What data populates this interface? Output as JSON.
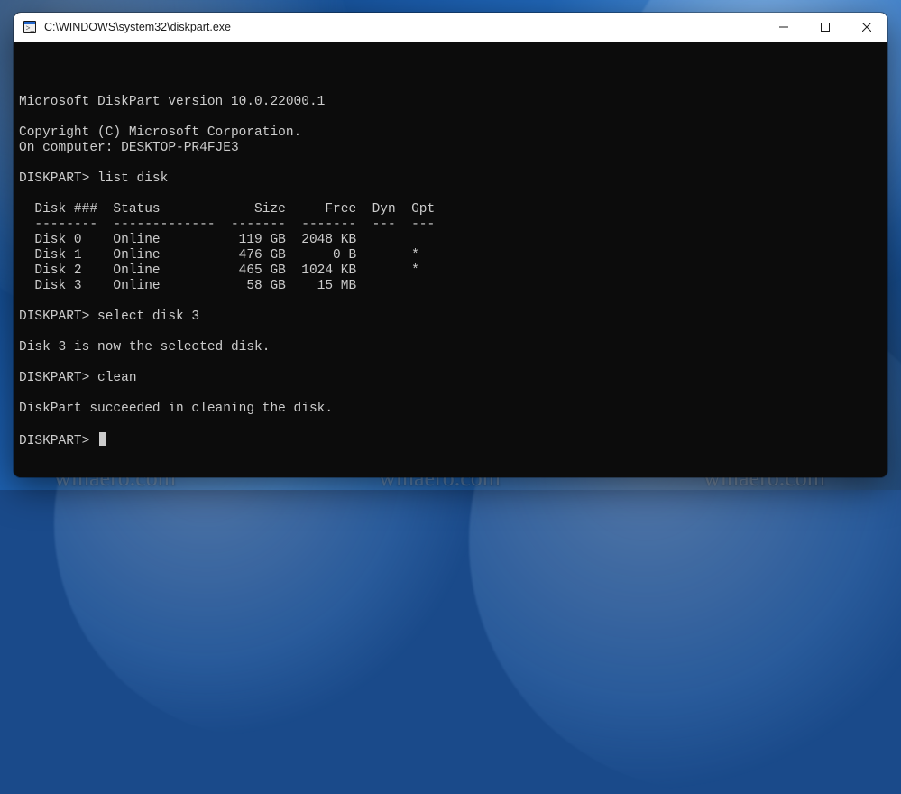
{
  "watermark": "winaero.com",
  "window": {
    "title": "C:\\WINDOWS\\system32\\diskpart.exe"
  },
  "terminal": {
    "version_line": "Microsoft DiskPart version 10.0.22000.1",
    "copyright_line": "Copyright (C) Microsoft Corporation.",
    "computer_line": "On computer: DESKTOP-PR4FJE3",
    "prompt": "DISKPART>",
    "cmd_list": "list disk",
    "cmd_select": "select disk 3",
    "cmd_clean": "clean",
    "select_result": "Disk 3 is now the selected disk.",
    "clean_result": "DiskPart succeeded in cleaning the disk.",
    "table": {
      "header": {
        "disk": "Disk ###",
        "status": "Status",
        "size": "Size",
        "free": "Free",
        "dyn": "Dyn",
        "gpt": "Gpt"
      },
      "sep": {
        "disk": "--------",
        "status": "-------------",
        "size": "-------",
        "free": "-------",
        "dyn": "---",
        "gpt": "---"
      },
      "rows": [
        {
          "disk": "Disk 0",
          "status": "Online",
          "size": "119 GB",
          "free": "2048 KB",
          "dyn": "",
          "gpt": ""
        },
        {
          "disk": "Disk 1",
          "status": "Online",
          "size": "476 GB",
          "free": "0 B",
          "dyn": "",
          "gpt": "*"
        },
        {
          "disk": "Disk 2",
          "status": "Online",
          "size": "465 GB",
          "free": "1024 KB",
          "dyn": "",
          "gpt": "*"
        },
        {
          "disk": "Disk 3",
          "status": "Online",
          "size": "58 GB",
          "free": "15 MB",
          "dyn": "",
          "gpt": ""
        }
      ]
    }
  }
}
